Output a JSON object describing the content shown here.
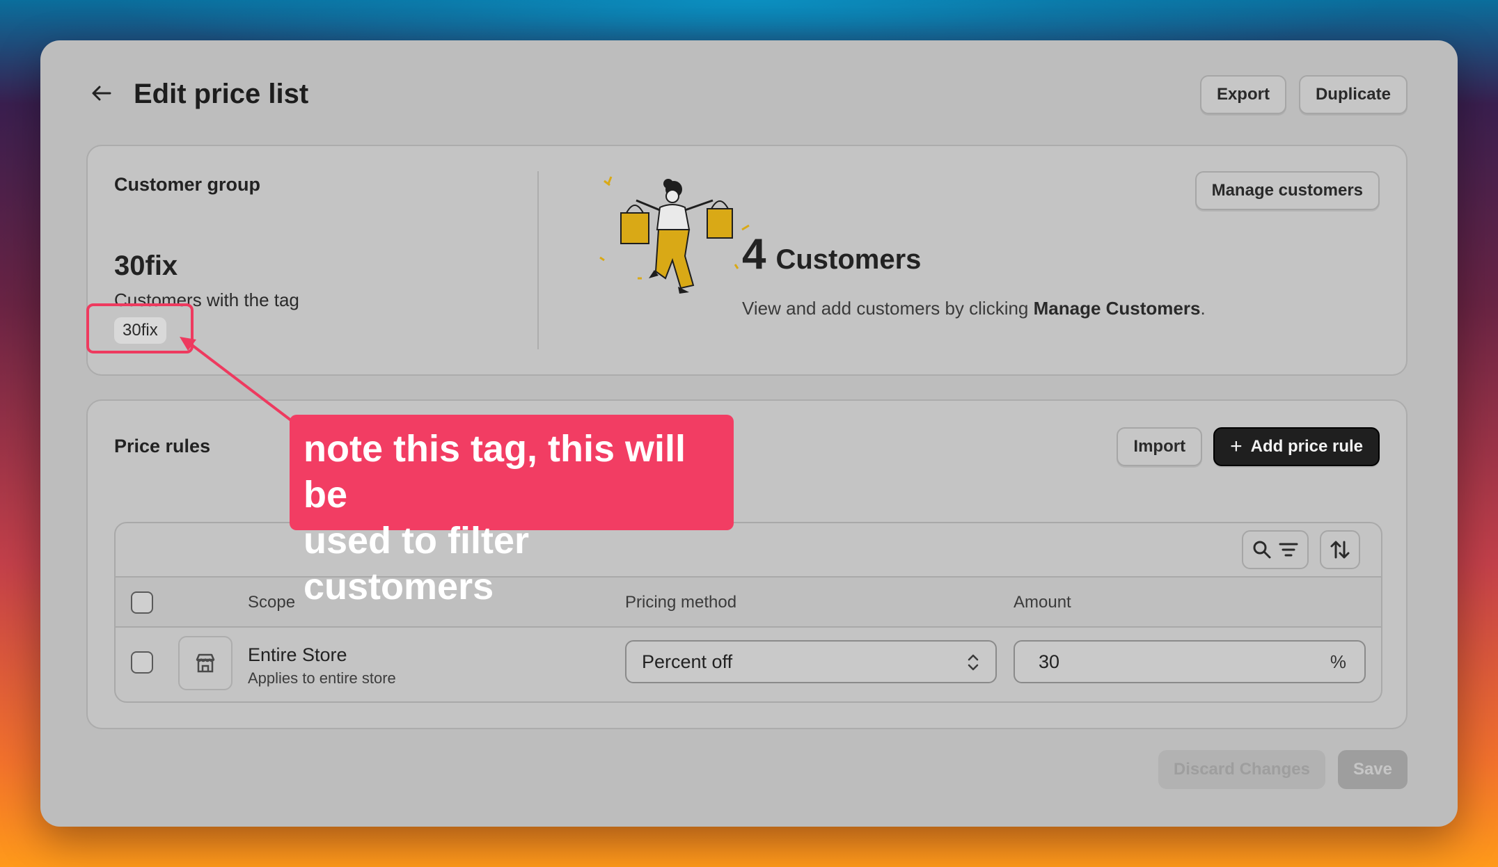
{
  "page": {
    "title": "Edit price list",
    "actions": {
      "export": "Export",
      "duplicate": "Duplicate"
    }
  },
  "customer_group": {
    "heading": "Customer group",
    "name": "30fix",
    "description": "Customers with the tag",
    "tag": "30fix",
    "manage_button": "Manage customers",
    "count": "4",
    "count_label": "Customers",
    "hint_prefix": "View and add customers by clicking ",
    "hint_bold": "Manage Customers",
    "hint_suffix": "."
  },
  "price_rules": {
    "heading": "Price rules",
    "import_button": "Import",
    "add_button": "Add price rule",
    "columns": {
      "scope": "Scope",
      "pricing_method": "Pricing method",
      "amount": "Amount"
    },
    "rows": [
      {
        "scope": "Entire Store",
        "scope_sub": "Applies to entire store",
        "pricing_method": "Percent off",
        "amount": "30",
        "amount_unit": "%"
      }
    ]
  },
  "footer": {
    "discard": "Discard Changes",
    "save": "Save"
  },
  "annotation": {
    "line1": "note this tag, this will be",
    "line2": "used to filter customers",
    "color": "#f23d63"
  },
  "icons": {
    "back": "arrow-left-icon",
    "search": "search-icon",
    "filter": "filter-icon",
    "sort": "sort-icon",
    "store": "store-icon",
    "chevron": "chevron-up-down-icon",
    "plus": "plus-icon"
  }
}
